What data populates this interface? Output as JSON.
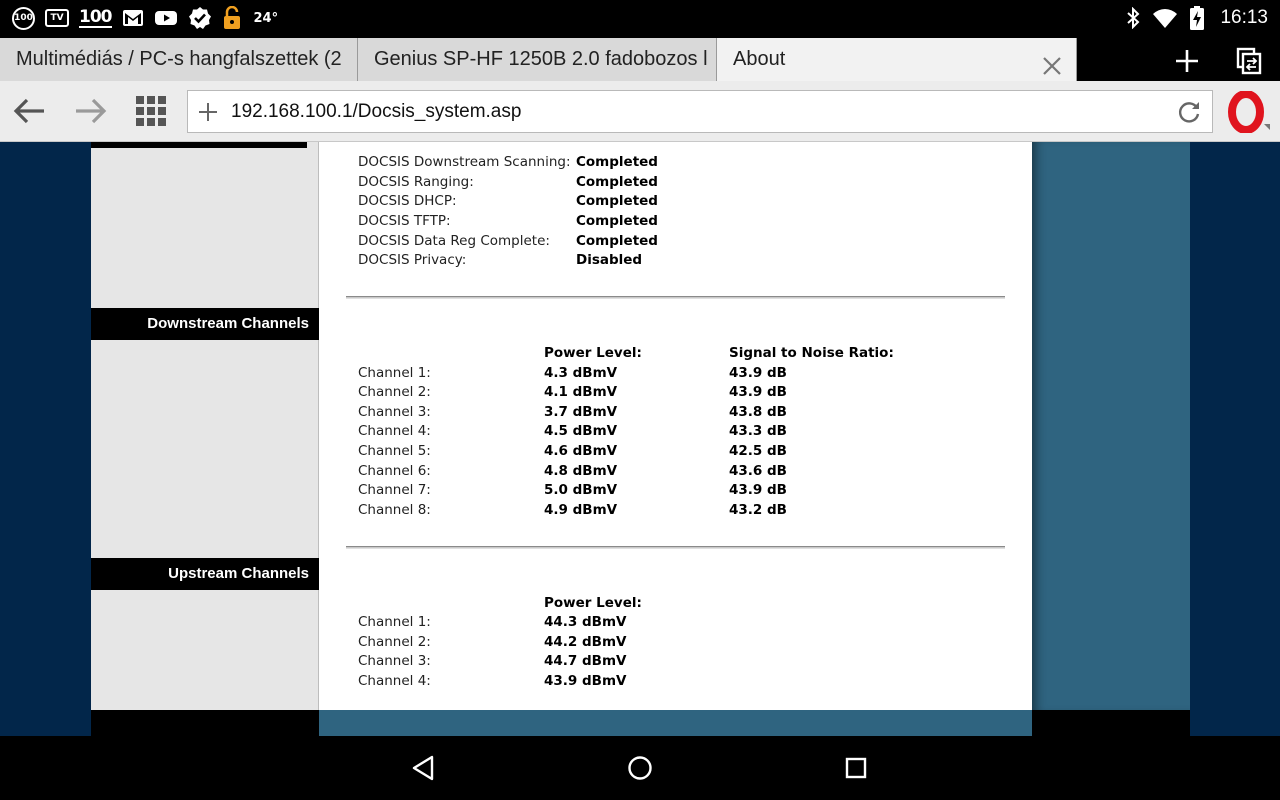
{
  "status_bar": {
    "icons": [
      "100-badge-icon",
      "tv-icon",
      "100-news-icon",
      "gmail-icon",
      "youtube-icon",
      "checkmark-badge-icon",
      "lock-icon",
      "bluetooth-icon",
      "wifi-icon",
      "battery-charging-icon"
    ],
    "badge_100": "100",
    "tv_label": "TV",
    "news_100": "100",
    "temperature": "24°",
    "time": "16:13"
  },
  "tabs": [
    {
      "title": "Multimédiás / PC-s hangfalszettek (2",
      "active": false
    },
    {
      "title": "Genius SP-HF 1250B 2.0 fadobozos l",
      "active": false
    },
    {
      "title": "About",
      "active": true
    }
  ],
  "toolbar": {
    "url": "192.168.100.1/Docsis_system.asp"
  },
  "sidebar": {
    "downstream_header": "Downstream Channels",
    "upstream_header": "Upstream Channels"
  },
  "docsis_status": [
    {
      "label": "DOCSIS Downstream Scanning:",
      "value": "Completed"
    },
    {
      "label": "DOCSIS Ranging:",
      "value": "Completed"
    },
    {
      "label": "DOCSIS DHCP:",
      "value": "Completed"
    },
    {
      "label": "DOCSIS TFTP:",
      "value": "Completed"
    },
    {
      "label": "DOCSIS Data Reg Complete:",
      "value": "Completed"
    },
    {
      "label": "DOCSIS Privacy:",
      "value": "Disabled"
    }
  ],
  "downstream": {
    "power_header": "Power Level:",
    "snr_header": "Signal to Noise Ratio:",
    "channels": [
      {
        "label": "Channel 1:",
        "power": "4.3 dBmV",
        "snr": "43.9 dB"
      },
      {
        "label": "Channel 2:",
        "power": "4.1 dBmV",
        "snr": "43.9 dB"
      },
      {
        "label": "Channel 3:",
        "power": "3.7 dBmV",
        "snr": "43.8 dB"
      },
      {
        "label": "Channel 4:",
        "power": "4.5 dBmV",
        "snr": "43.3 dB"
      },
      {
        "label": "Channel 5:",
        "power": "4.6 dBmV",
        "snr": "42.5 dB"
      },
      {
        "label": "Channel 6:",
        "power": "4.8 dBmV",
        "snr": "43.6 dB"
      },
      {
        "label": "Channel 7:",
        "power": "5.0 dBmV",
        "snr": "43.9 dB"
      },
      {
        "label": "Channel 8:",
        "power": "4.9 dBmV",
        "snr": "43.2 dB"
      }
    ]
  },
  "upstream": {
    "power_header": "Power Level:",
    "channels": [
      {
        "label": "Channel 1:",
        "power": "44.3 dBmV"
      },
      {
        "label": "Channel 2:",
        "power": "44.2 dBmV"
      },
      {
        "label": "Channel 3:",
        "power": "44.7 dBmV"
      },
      {
        "label": "Channel 4:",
        "power": "43.9 dBmV"
      }
    ]
  },
  "nav_bar": {
    "icons": [
      "back-triangle-icon",
      "home-circle-icon",
      "recents-square-icon"
    ]
  },
  "colors": {
    "page_background": "#02264a",
    "side_panel": "#2f6480",
    "section_header": "#000000",
    "opera_red": "#e0141e"
  }
}
